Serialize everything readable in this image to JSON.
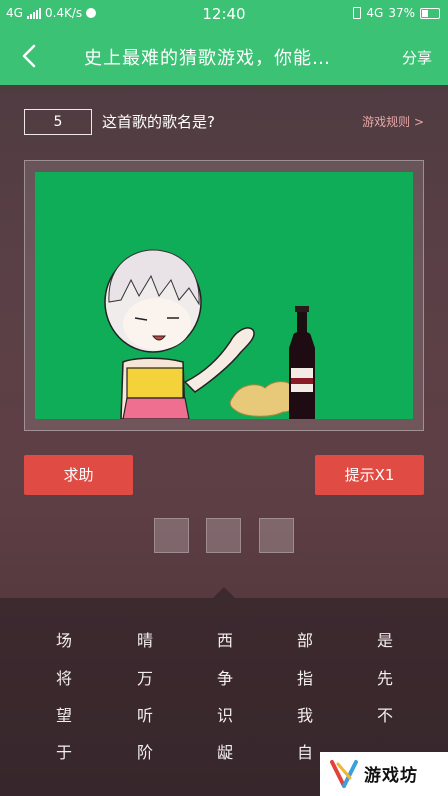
{
  "status": {
    "network_left": "4G",
    "speed": "0.4K/s",
    "time": "12:40",
    "network_right": "4G",
    "battery": "37%"
  },
  "header": {
    "title": "史上最难的猜歌游戏，你能…",
    "share": "分享"
  },
  "question": {
    "level": "5",
    "prompt": "这首歌的歌名是?",
    "rules": "游戏规则 >"
  },
  "actions": {
    "help": "求助",
    "hint": "提示X1"
  },
  "answer_slots": [
    "",
    "",
    ""
  ],
  "keyboard": [
    [
      "场",
      "晴",
      "西",
      "部",
      "是"
    ],
    [
      "将",
      "万",
      "争",
      "指",
      "先"
    ],
    [
      "望",
      "听",
      "识",
      "我",
      "不"
    ],
    [
      "于",
      "阶",
      "龊",
      "自",
      ""
    ]
  ],
  "watermark": {
    "text": "游戏坊"
  },
  "colors": {
    "accent": "#3cc275",
    "button": "#e04b43",
    "scene_bg": "#10ad58"
  }
}
